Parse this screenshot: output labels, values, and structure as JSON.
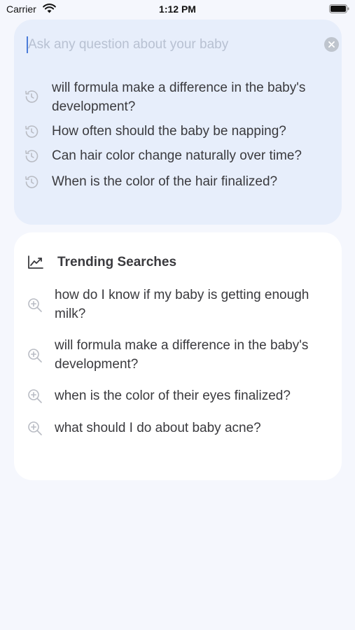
{
  "status_bar": {
    "carrier": "Carrier",
    "time": "1:12 PM"
  },
  "search": {
    "placeholder": "Ask any question about your baby",
    "value": "",
    "clear_icon": "clear-icon"
  },
  "recent_searches": [
    {
      "text": "will formula make a difference in the baby's development?",
      "icon": "history-icon"
    },
    {
      "text": "How often should the baby be napping?",
      "icon": "history-icon"
    },
    {
      "text": "Can hair color change naturally over time?",
      "icon": "history-icon"
    },
    {
      "text": "When is the color of the hair finalized?",
      "icon": "history-icon"
    }
  ],
  "trending": {
    "title": "Trending Searches",
    "icon": "trending-chart-icon",
    "items": [
      {
        "text": "how do I know if my baby is getting enough milk?",
        "icon": "zoom-search-icon"
      },
      {
        "text": "will formula make a difference in the baby's development?",
        "icon": "zoom-search-icon"
      },
      {
        "text": "when is the color of their eyes finalized?",
        "icon": "zoom-search-icon"
      },
      {
        "text": "what should I do about baby acne?",
        "icon": "zoom-search-icon"
      }
    ]
  },
  "colors": {
    "background": "#f5f7fd",
    "search_card": "#e7eefb",
    "trending_card": "#ffffff",
    "caret": "#4a7bd8",
    "icon_gray": "#b9bcc4"
  }
}
